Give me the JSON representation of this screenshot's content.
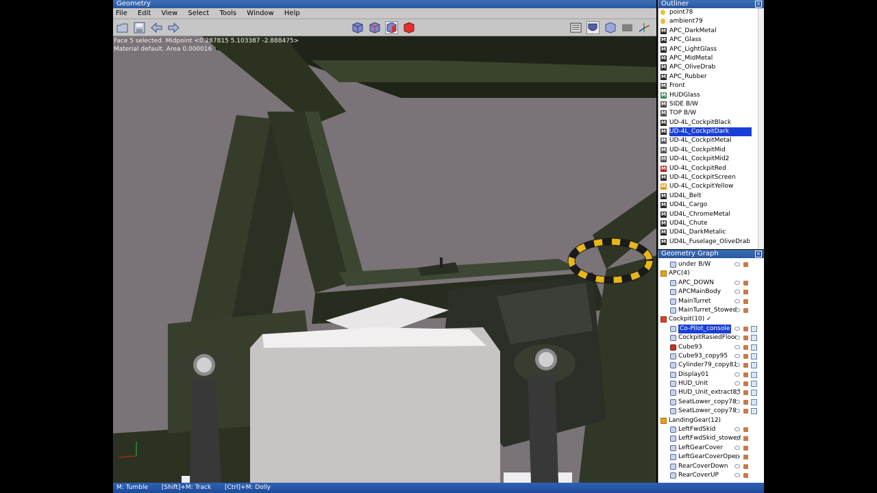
{
  "geometry_window": {
    "title": "Geometry",
    "menu": [
      "File",
      "Edit",
      "View",
      "Select",
      "Tools",
      "Window",
      "Help"
    ],
    "status_line1": "Face 5 selected. Midpoint <0.287815  5.103387  -2.888475>",
    "status_line2": "Material default. Area 0.000016"
  },
  "toolbar": {
    "left_icons": [
      "open-icon",
      "save-icon",
      "undo-icon",
      "redo-icon"
    ],
    "mode_icons": [
      "vertex-mode-icon",
      "edge-mode-icon",
      "face-mode-icon",
      "object-mode-icon"
    ],
    "right_icons": [
      "wireframe-icon",
      "shaded-icon",
      "texture-icon",
      "grid-icon",
      "axes-icon"
    ]
  },
  "statusbar": {
    "tumble": "M: Tumble",
    "track": "[Shift]+M: Track",
    "dolly": "[Ctrl]+M: Dolly"
  },
  "outliner": {
    "title": "Outliner",
    "items": [
      {
        "label": "point78",
        "icon": "light",
        "color": "#e8c23a"
      },
      {
        "label": "ambient79",
        "icon": "light",
        "color": "#e8c23a"
      },
      {
        "label": "APC_DarkMetal",
        "icon": "M",
        "color": "#2a2a2a"
      },
      {
        "label": "APC_Glass",
        "icon": "M",
        "color": "#2a2a2a"
      },
      {
        "label": "APC_LightGlass",
        "icon": "M",
        "color": "#2a2a2a"
      },
      {
        "label": "APC_MidMetal",
        "icon": "M",
        "color": "#2a2a2a"
      },
      {
        "label": "APC_OliveDrab",
        "icon": "M",
        "color": "#2a2a2a"
      },
      {
        "label": "APC_Rubber",
        "icon": "M",
        "color": "#2a2a2a"
      },
      {
        "label": "Front",
        "icon": "M",
        "color": "#4a4a4a"
      },
      {
        "label": "HUDGlass",
        "icon": "M",
        "color": "#3a8a5a"
      },
      {
        "label": "SIDE B/W",
        "icon": "M",
        "color": "#4a4a4a"
      },
      {
        "label": "TOP B/W",
        "icon": "M",
        "color": "#4a4a4a"
      },
      {
        "label": "UD-4L_CockpitBlack",
        "icon": "M",
        "color": "#2a2a2a"
      },
      {
        "label": "UD-4L_CockpitDark",
        "icon": "M",
        "color": "#2a2a2a",
        "selected": true
      },
      {
        "label": "UD-4L_CockpitMetal",
        "icon": "M",
        "color": "#555555"
      },
      {
        "label": "UD-4L_CockpitMid",
        "icon": "M",
        "color": "#555555"
      },
      {
        "label": "UD-4L_CockpitMid2",
        "icon": "M",
        "color": "#555555"
      },
      {
        "label": "UD-4L_CockpitRed",
        "icon": "M",
        "color": "#b02020"
      },
      {
        "label": "UD-4L_CockpitScreen",
        "icon": "M",
        "color": "#2a2a2a"
      },
      {
        "label": "UD-4L_CockpitYellow",
        "icon": "M",
        "color": "#d89a10"
      },
      {
        "label": "UD4L_Belt",
        "icon": "M",
        "color": "#2a2a2a"
      },
      {
        "label": "UD4L_Cargo",
        "icon": "M",
        "color": "#2a2a2a"
      },
      {
        "label": "UD4L_ChromeMetal",
        "icon": "M",
        "color": "#2a2a2a"
      },
      {
        "label": "UD4L_Chute",
        "icon": "M",
        "color": "#2a2a2a"
      },
      {
        "label": "UD4L_DarkMetalic",
        "icon": "M",
        "color": "#2a2a2a"
      },
      {
        "label": "UD4L_Fuselage_OliveDrab",
        "icon": "M",
        "color": "#2a2a2a"
      }
    ]
  },
  "geometry_graph": {
    "title": "Geometry Graph",
    "rows": [
      {
        "label": "under B/W",
        "type": "mesh",
        "indent": 1,
        "cube": false
      },
      {
        "label": "APC(4)",
        "type": "folder",
        "indent": 0,
        "cube": false
      },
      {
        "label": "APC_DOWN",
        "type": "mesh",
        "indent": 1,
        "cube": false
      },
      {
        "label": "APCMainBody",
        "type": "mesh",
        "indent": 1,
        "cube": false
      },
      {
        "label": "MainTurret",
        "type": "mesh",
        "indent": 1,
        "cube": false
      },
      {
        "label": "MainTurret_Stowed",
        "type": "mesh",
        "indent": 1,
        "cube": false
      },
      {
        "label": "Cockpit(10) ✓",
        "type": "folder-red",
        "indent": 0,
        "cube": false
      },
      {
        "label": "Co-Pilot_console",
        "type": "mesh",
        "indent": 1,
        "cube": true,
        "selected": true
      },
      {
        "label": "CockpitRasiedFloor",
        "type": "mesh",
        "indent": 1,
        "cube": true
      },
      {
        "label": "Cube93",
        "type": "mesh-red",
        "indent": 1,
        "cube": true
      },
      {
        "label": "Cube93_copy95",
        "type": "mesh",
        "indent": 1,
        "cube": true
      },
      {
        "label": "Cylinder79_copy81",
        "type": "mesh",
        "indent": 1,
        "cube": true
      },
      {
        "label": "Display01",
        "type": "mesh",
        "indent": 1,
        "cube": true
      },
      {
        "label": "HUD_Unit",
        "type": "mesh",
        "indent": 1,
        "cube": true
      },
      {
        "label": "HUD_Unit_extract83",
        "type": "mesh",
        "indent": 1,
        "cube": true
      },
      {
        "label": "SeatLower_copy78",
        "type": "mesh",
        "indent": 1,
        "cube": true
      },
      {
        "label": "SeatLower_copy78",
        "type": "mesh",
        "indent": 1,
        "cube": true
      },
      {
        "label": "LandingGear(12)",
        "type": "folder",
        "indent": 0,
        "cube": false
      },
      {
        "label": "LeftFwdSkid",
        "type": "mesh",
        "indent": 1,
        "cube": false
      },
      {
        "label": "LeftFwdSkid_stowed",
        "type": "mesh",
        "indent": 1,
        "cube": false
      },
      {
        "label": "LeftGearCover",
        "type": "mesh",
        "indent": 1,
        "cube": false
      },
      {
        "label": "LeftGearCoverOpen",
        "type": "mesh",
        "indent": 1,
        "cube": false
      },
      {
        "label": "RearCoverDown",
        "type": "mesh",
        "indent": 1,
        "cube": false
      },
      {
        "label": "RearCoverUP",
        "type": "mesh",
        "indent": 1,
        "cube": false
      }
    ]
  }
}
